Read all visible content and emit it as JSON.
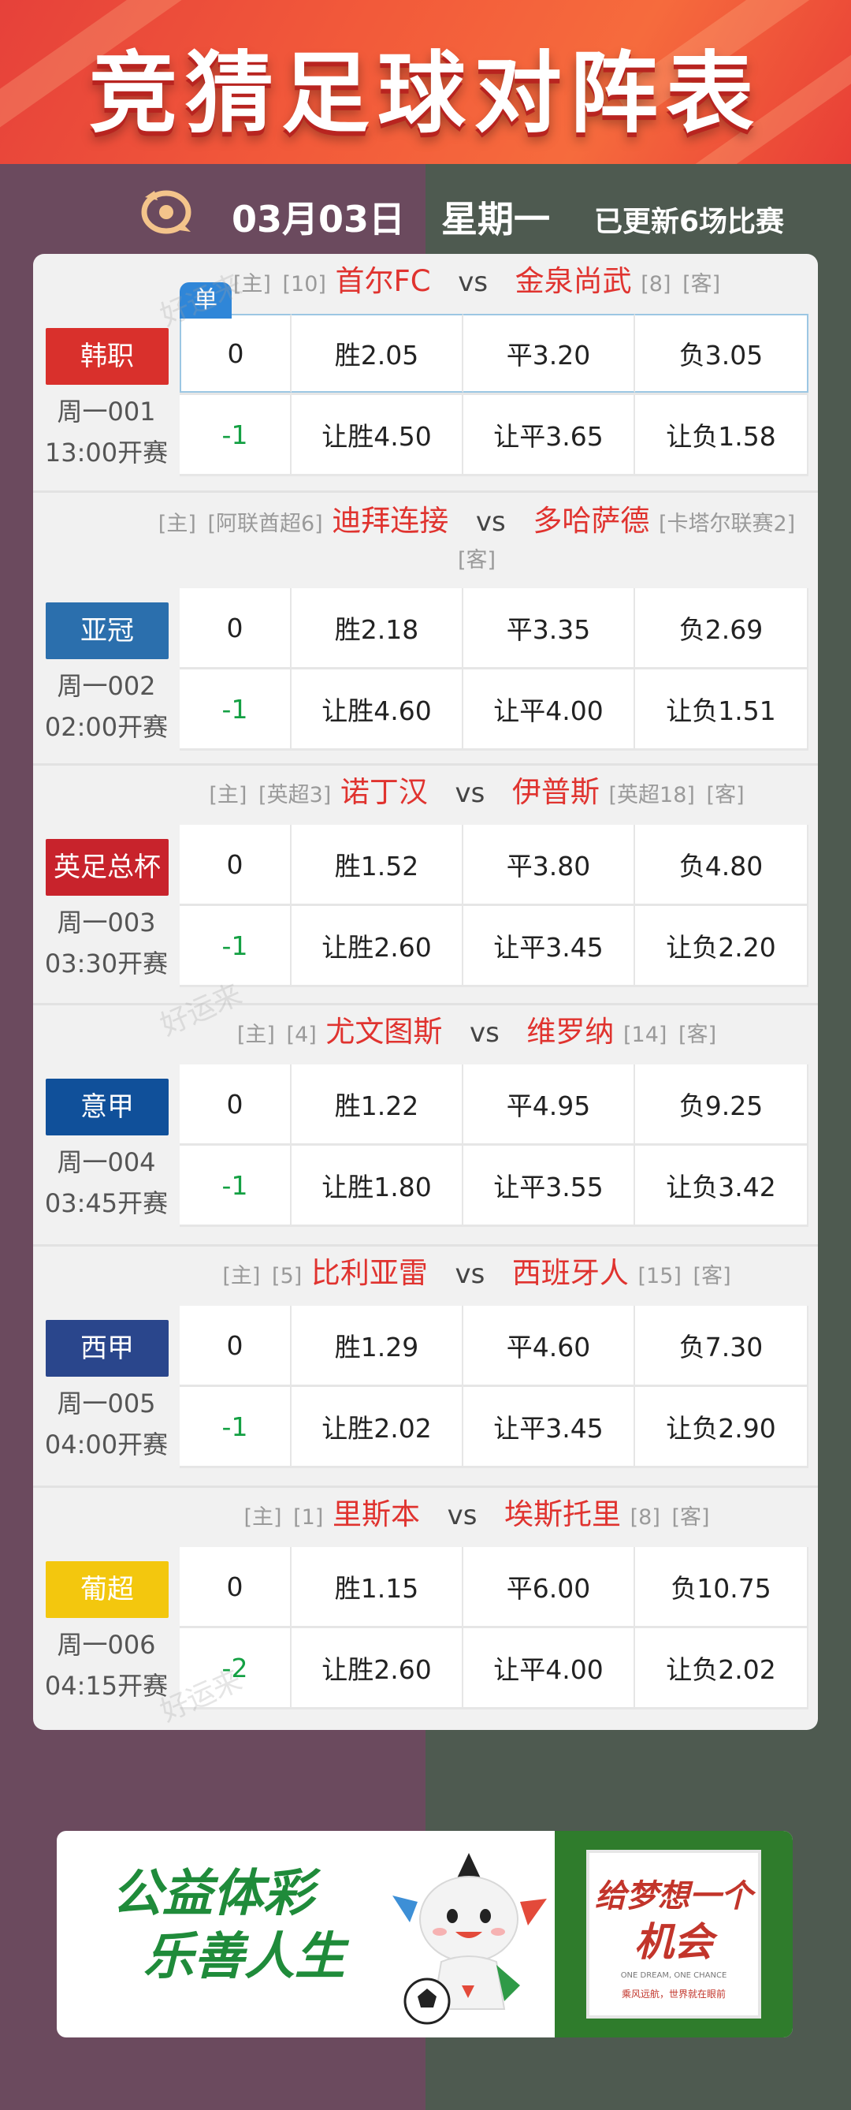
{
  "header": {
    "title": "竞猜足球对阵表"
  },
  "datebar": {
    "date": "03月03日",
    "weekday": "星期一",
    "update": "已更新6场比赛"
  },
  "single_badge": "单",
  "watermark": "好运来",
  "matches": [
    {
      "league": "韩职",
      "league_color": "#d9302c",
      "code": "周一001",
      "kickoff": "13:00开赛",
      "home_tag": "[主]",
      "home_rank": "[10]",
      "home": "首尔FC",
      "vs": "vs",
      "away": "金泉尚武",
      "away_rank": "[8]",
      "away_tag": "[客]",
      "handicap0": "0",
      "win": "胜2.05",
      "draw": "平3.20",
      "lose": "负3.05",
      "handicap": "-1",
      "hwin": "让胜4.50",
      "hdraw": "让平3.65",
      "hlose": "让负1.58"
    },
    {
      "league": "亚冠",
      "league_color": "#2b6fad",
      "code": "周一002",
      "kickoff": "02:00开赛",
      "home_tag": "[主]",
      "home_rank": "[阿联酋超6]",
      "home": "迪拜连接",
      "vs": "vs",
      "away": "多哈萨德",
      "away_rank": "[卡塔尔联赛2]",
      "away_tag": "[客]",
      "handicap0": "0",
      "win": "胜2.18",
      "draw": "平3.35",
      "lose": "负2.69",
      "handicap": "-1",
      "hwin": "让胜4.60",
      "hdraw": "让平4.00",
      "hlose": "让负1.51"
    },
    {
      "league": "英足总杯",
      "league_color": "#c8232c",
      "code": "周一003",
      "kickoff": "03:30开赛",
      "home_tag": "[主]",
      "home_rank": "[英超3]",
      "home": "诺丁汉",
      "vs": "vs",
      "away": "伊普斯",
      "away_rank": "[英超18]",
      "away_tag": "[客]",
      "handicap0": "0",
      "win": "胜1.52",
      "draw": "平3.80",
      "lose": "负4.80",
      "handicap": "-1",
      "hwin": "让胜2.60",
      "hdraw": "让平3.45",
      "hlose": "让负2.20"
    },
    {
      "league": "意甲",
      "league_color": "#10509a",
      "code": "周一004",
      "kickoff": "03:45开赛",
      "home_tag": "[主]",
      "home_rank": "[4]",
      "home": "尤文图斯",
      "vs": "vs",
      "away": "维罗纳",
      "away_rank": "[14]",
      "away_tag": "[客]",
      "handicap0": "0",
      "win": "胜1.22",
      "draw": "平4.95",
      "lose": "负9.25",
      "handicap": "-1",
      "hwin": "让胜1.80",
      "hdraw": "让平3.55",
      "hlose": "让负3.42"
    },
    {
      "league": "西甲",
      "league_color": "#2a468c",
      "code": "周一005",
      "kickoff": "04:00开赛",
      "home_tag": "[主]",
      "home_rank": "[5]",
      "home": "比利亚雷",
      "vs": "vs",
      "away": "西班牙人",
      "away_rank": "[15]",
      "away_tag": "[客]",
      "handicap0": "0",
      "win": "胜1.29",
      "draw": "平4.60",
      "lose": "负7.30",
      "handicap": "-1",
      "hwin": "让胜2.02",
      "hdraw": "让平3.45",
      "hlose": "让负2.90"
    },
    {
      "league": "葡超",
      "league_color": "#f3c70e",
      "code": "周一006",
      "kickoff": "04:15开赛",
      "home_tag": "[主]",
      "home_rank": "[1]",
      "home": "里斯本",
      "vs": "vs",
      "away": "埃斯托里",
      "away_rank": "[8]",
      "away_tag": "[客]",
      "handicap0": "0",
      "win": "胜1.15",
      "draw": "平6.00",
      "lose": "负10.75",
      "handicap": "-2",
      "hwin": "让胜2.60",
      "hdraw": "让平4.00",
      "hlose": "让负2.02"
    }
  ],
  "ad": {
    "line1": "公益体彩",
    "line2": "乐善人生",
    "stamp_line1": "给梦想一个",
    "stamp_line2": "机会",
    "stamp_en": "ONE DREAM, ONE CHANCE",
    "stamp_cn": "乘风远航，世界就在眼前"
  }
}
